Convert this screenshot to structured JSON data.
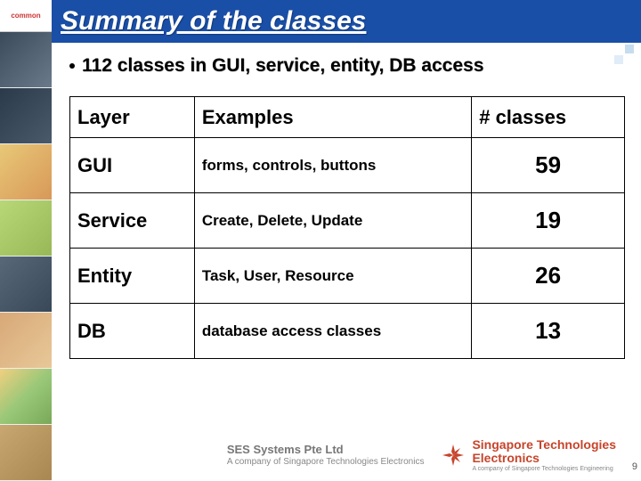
{
  "sidebar": {
    "logo_text": "common"
  },
  "title": "Summary of the classes",
  "bullet": "112 classes in GUI, service, entity, DB access",
  "table": {
    "headers": {
      "layer": "Layer",
      "examples": "Examples",
      "count": "# classes"
    },
    "rows": [
      {
        "layer": "GUI",
        "examples": "forms, controls, buttons",
        "count": "59"
      },
      {
        "layer": "Service",
        "examples": "Create, Delete, Update",
        "count": "19"
      },
      {
        "layer": "Entity",
        "examples": "Task, User, Resource",
        "count": "26"
      },
      {
        "layer": "DB",
        "examples": "database access classes",
        "count": "13"
      }
    ]
  },
  "footer": {
    "company_name": "SES Systems Pte Ltd",
    "company_sub": "A company of Singapore Technologies Electronics",
    "st_name": "Singapore Technologies",
    "st_div": "Electronics",
    "st_sub": "A company of Singapore Technologies Engineering"
  },
  "page_number": "9",
  "chart_data": {
    "type": "table",
    "title": "Summary of the classes",
    "columns": [
      "Layer",
      "Examples",
      "# classes"
    ],
    "rows": [
      [
        "GUI",
        "forms, controls, buttons",
        59
      ],
      [
        "Service",
        "Create, Delete, Update",
        19
      ],
      [
        "Entity",
        "Task, User, Resource",
        26
      ],
      [
        "DB",
        "database access classes",
        13
      ]
    ],
    "total_classes": 112
  }
}
